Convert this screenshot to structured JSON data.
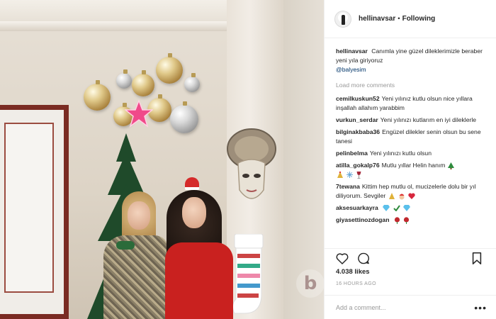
{
  "post": {
    "username": "hellinavsar",
    "dot": "•",
    "follow_status": "Following",
    "caption": {
      "user": "hellinavsar",
      "text": "Canımla yine güzel dileklerimizle beraber yeni yıla giriyoruz",
      "mention": "@balyesim"
    },
    "load_more": "Load more comments",
    "comments": [
      {
        "user": "cemilkuskun52",
        "text": "Yeni yılınız kutlu olsun nice yıllara inşallah allahım yarabbim"
      },
      {
        "user": "vurkun_serdar",
        "text": "Yeni yılınızı kutlarım en iyi dileklerle"
      },
      {
        "user": "bilginakbaba36",
        "text": "Engüzel dilekler senin olsun bu sene tanesi"
      },
      {
        "user": "pelinbelma",
        "text": "Yeni yılınızı kutlu olsun"
      },
      {
        "user": "atilla_gokalp76",
        "text": "Mutlu yıllar Helin hanım"
      },
      {
        "user": "7tewana",
        "text": "Kittim hep mutlu ol, mucizelerle dolu bir yıl diliyorum. Sevgiler"
      },
      {
        "user": "aksesuarkayra",
        "text": ""
      },
      {
        "user": "giyasettinozdogan",
        "text": ""
      }
    ],
    "likes": "4.038 likes",
    "timestamp": "16 HOURS AGO",
    "add_comment_placeholder": "Add a comment...",
    "more_options": "•••",
    "watermark": "b"
  },
  "icons": {
    "like": "heart-icon",
    "comment": "comment-bubble-icon",
    "save": "bookmark-icon"
  },
  "colors": {
    "text": "#262626",
    "muted": "#999999",
    "mention": "#003569",
    "border": "#efefef"
  }
}
